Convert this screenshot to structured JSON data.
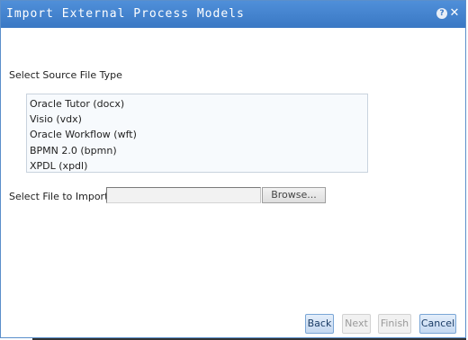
{
  "dialog": {
    "title": "Import External Process Models",
    "help_icon": "?",
    "close_icon": "✕"
  },
  "source_section": {
    "label": "Select Source File Type",
    "file_types": [
      "Oracle Tutor (docx)",
      "Visio (vdx)",
      "Oracle Workflow (wft)",
      "BPMN 2.0 (bpmn)",
      "XPDL (xpdl)"
    ]
  },
  "import_section": {
    "label": "Select File to Import",
    "file_value": "",
    "browse_label": "Browse..."
  },
  "footer": {
    "back_label": "Back",
    "next_label": "Next",
    "finish_label": "Finish",
    "cancel_label": "Cancel"
  },
  "colors": {
    "titlebar": "#3a78c4",
    "button_active": "#c4d8f1",
    "list_border": "#c9d3de"
  }
}
